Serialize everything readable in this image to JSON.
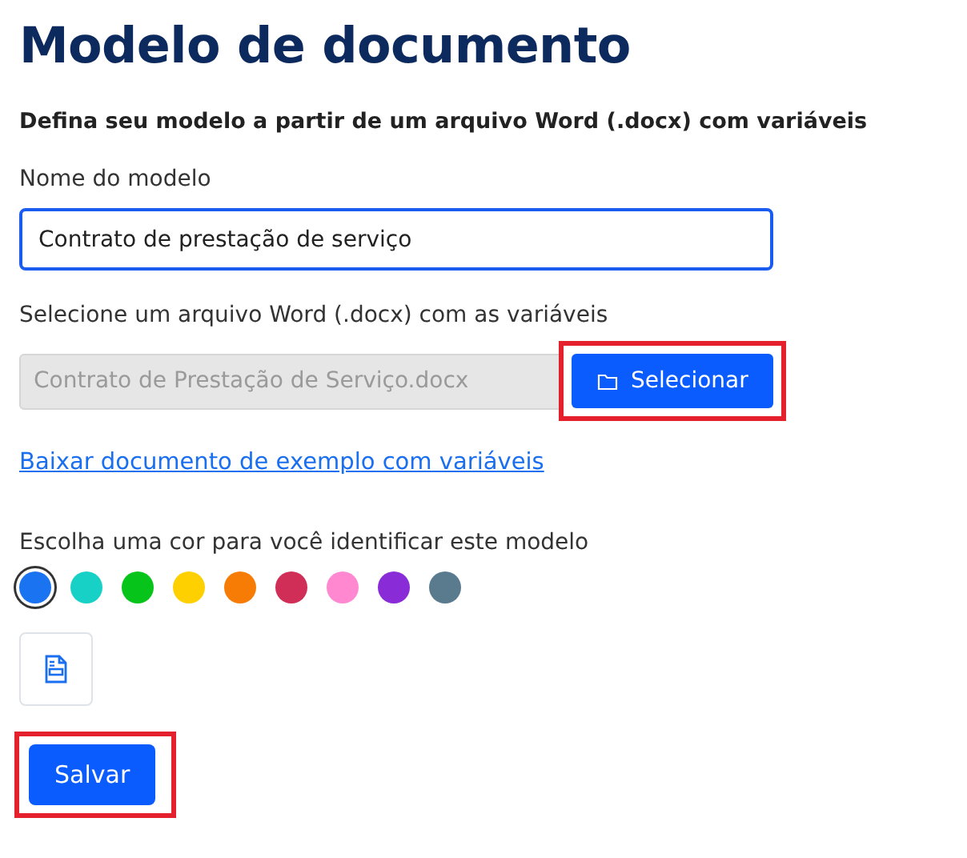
{
  "title": "Modelo de documento",
  "subtitle": "Defina seu modelo a partir de um arquivo Word (.docx) com variáveis",
  "name_field": {
    "label": "Nome do modelo",
    "value": "Contrato de prestação de serviço",
    "focused": true
  },
  "file_field": {
    "label": "Selecione um arquivo Word (.docx) com as variáveis",
    "value": "Contrato de Prestação de Serviço.docx",
    "button": "Selecionar",
    "highlighted": true
  },
  "example_link": "Baixar documento de exemplo com variáveis",
  "color_picker": {
    "label": "Escolha uma cor para você identificar este modelo",
    "colors": [
      {
        "color": "#1a73f0",
        "selected": true
      },
      {
        "color": "#17d1c6",
        "selected": false
      },
      {
        "color": "#07c41b",
        "selected": false
      },
      {
        "color": "#ffd000",
        "selected": false
      },
      {
        "color": "#f67c05",
        "selected": false
      },
      {
        "color": "#d02d57",
        "selected": false
      },
      {
        "color": "#ff88d1",
        "selected": false
      },
      {
        "color": "#8a2bd8",
        "selected": false
      },
      {
        "color": "#5a7a8e",
        "selected": false
      }
    ]
  },
  "save_button": {
    "label": "Salvar",
    "highlighted": true
  }
}
